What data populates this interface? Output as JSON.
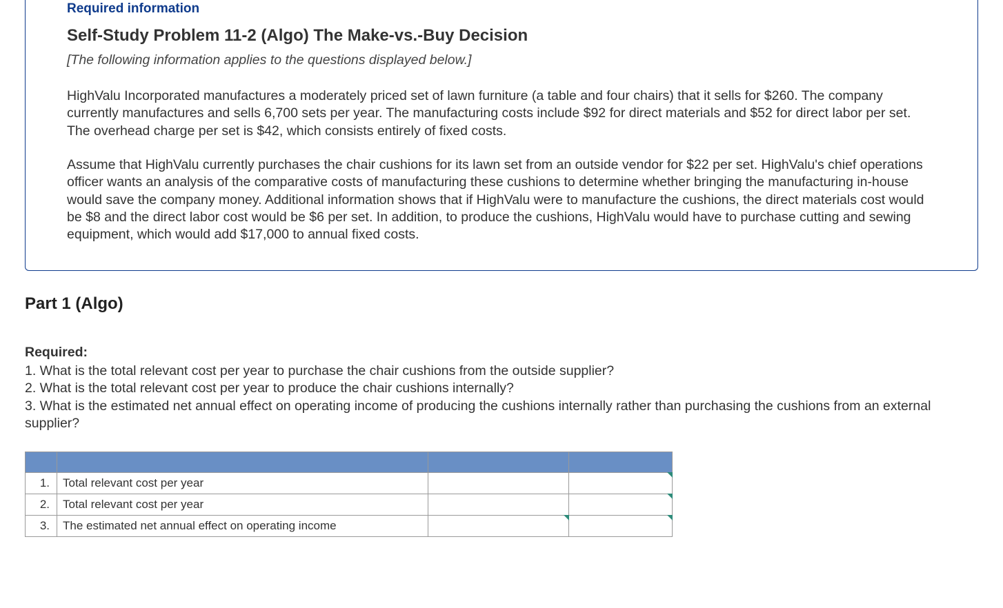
{
  "info": {
    "required_info_label": "Required information",
    "problem_title": "Self-Study Problem 11-2 (Algo) The Make-vs.-Buy Decision",
    "applies_note": "[The following information applies to the questions displayed below.]",
    "para1": "HighValu Incorporated manufactures a moderately priced set of lawn furniture (a table and four chairs) that it sells for $260. The company currently manufactures and sells 6,700 sets per year. The manufacturing costs include $92 for direct materials and $52 for direct labor per set. The overhead charge per set is $42, which consists entirely of fixed costs.",
    "para2": "Assume that HighValu currently purchases the chair cushions for its lawn set from an outside vendor for $22 per set. HighValu's chief operations officer wants an analysis of the comparative costs of manufacturing these cushions to determine whether bringing the manufacturing in-house would save the company money. Additional information shows that if HighValu were to manufacture the cushions, the direct materials cost would be $8 and the direct labor cost would be $6 per set. In addition, to produce the cushions, HighValu would have to purchase cutting and sewing equipment, which would add $17,000 to annual fixed costs."
  },
  "part_title": "Part 1 (Algo)",
  "required": {
    "label": "Required:",
    "items": [
      "1. What is the total relevant cost per year to purchase the chair cushions from the outside supplier?",
      "2. What is the total relevant cost per year to produce the chair cushions internally?",
      "3. What is the estimated net annual effect on operating income of producing the cushions internally rather than purchasing the cushions from an external supplier?"
    ]
  },
  "table": {
    "header": [
      "",
      "",
      "",
      ""
    ],
    "rows": [
      {
        "num": "1.",
        "label": "Total relevant cost per year",
        "value": "",
        "extra": ""
      },
      {
        "num": "2.",
        "label": "Total relevant cost per year",
        "value": "",
        "extra": ""
      },
      {
        "num": "3.",
        "label": "The estimated net annual effect on operating income",
        "value": "",
        "extra": ""
      }
    ]
  }
}
